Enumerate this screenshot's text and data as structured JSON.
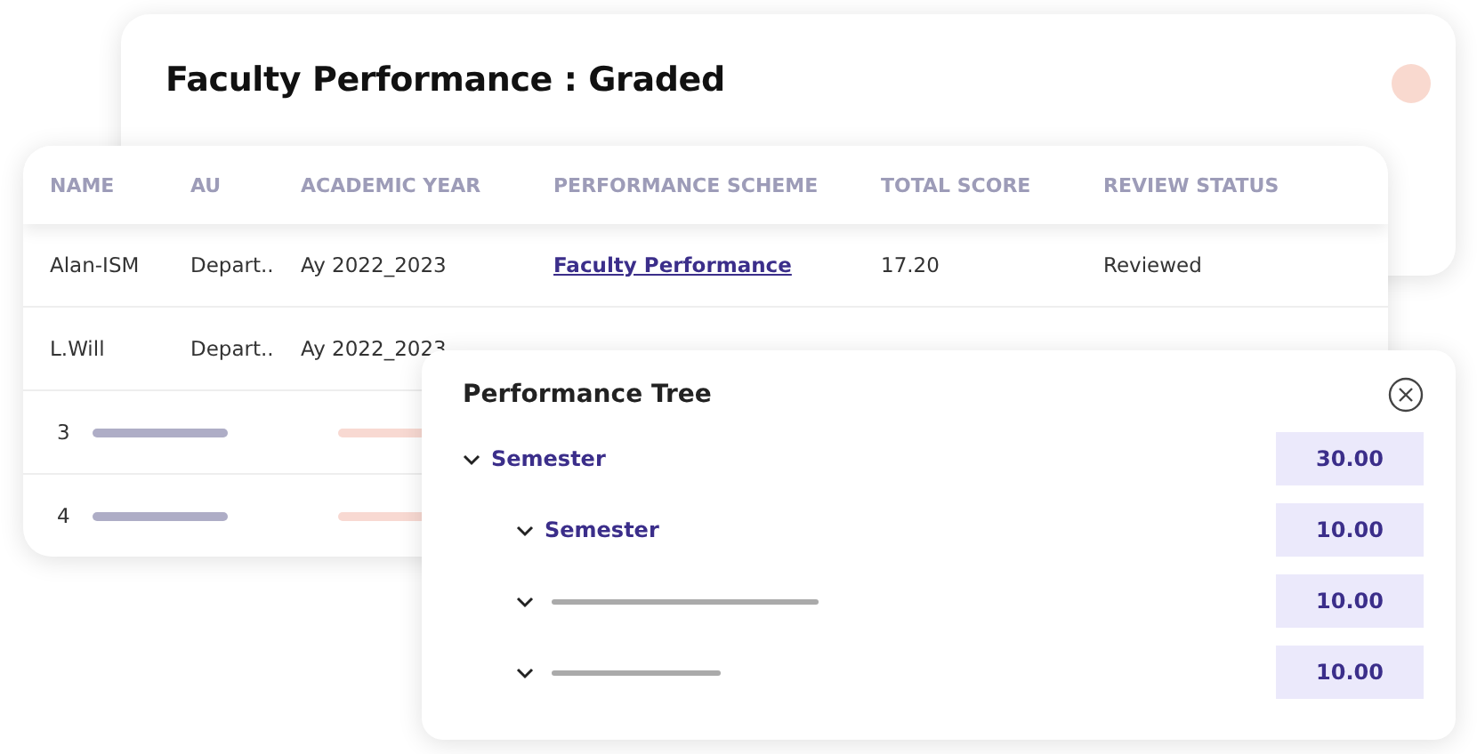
{
  "summary_card": {
    "title": "Faculty Performance : Graded"
  },
  "table": {
    "columns": [
      "NAME",
      "AU",
      "ACADEMIC YEAR",
      "PERFORMANCE SCHEME",
      "TOTAL SCORE",
      "REVIEW STATUS"
    ],
    "rows": [
      {
        "kind": "data",
        "name": "Alan-ISM",
        "au": "Depart..",
        "academic_year": "Ay 2022_2023",
        "scheme": "Faculty Performance",
        "total_score": "17.20",
        "review_status": "Reviewed"
      },
      {
        "kind": "data",
        "name": "L.Will",
        "au": "Depart..",
        "academic_year": "Ay 2022_2023"
      },
      {
        "kind": "skeleton",
        "index": "3"
      },
      {
        "kind": "skeleton",
        "index": "4"
      }
    ]
  },
  "performance_tree": {
    "title": "Performance Tree",
    "items": [
      {
        "kind": "label",
        "label": "Semester",
        "expanded": true,
        "score": "30.00",
        "children": [
          {
            "kind": "label",
            "label": "Semester",
            "expanded": true,
            "score": "10.00"
          },
          {
            "kind": "skeleton",
            "expanded": true,
            "score": "10.00"
          },
          {
            "kind": "skeleton",
            "expanded": true,
            "score": "10.00"
          }
        ]
      }
    ]
  }
}
